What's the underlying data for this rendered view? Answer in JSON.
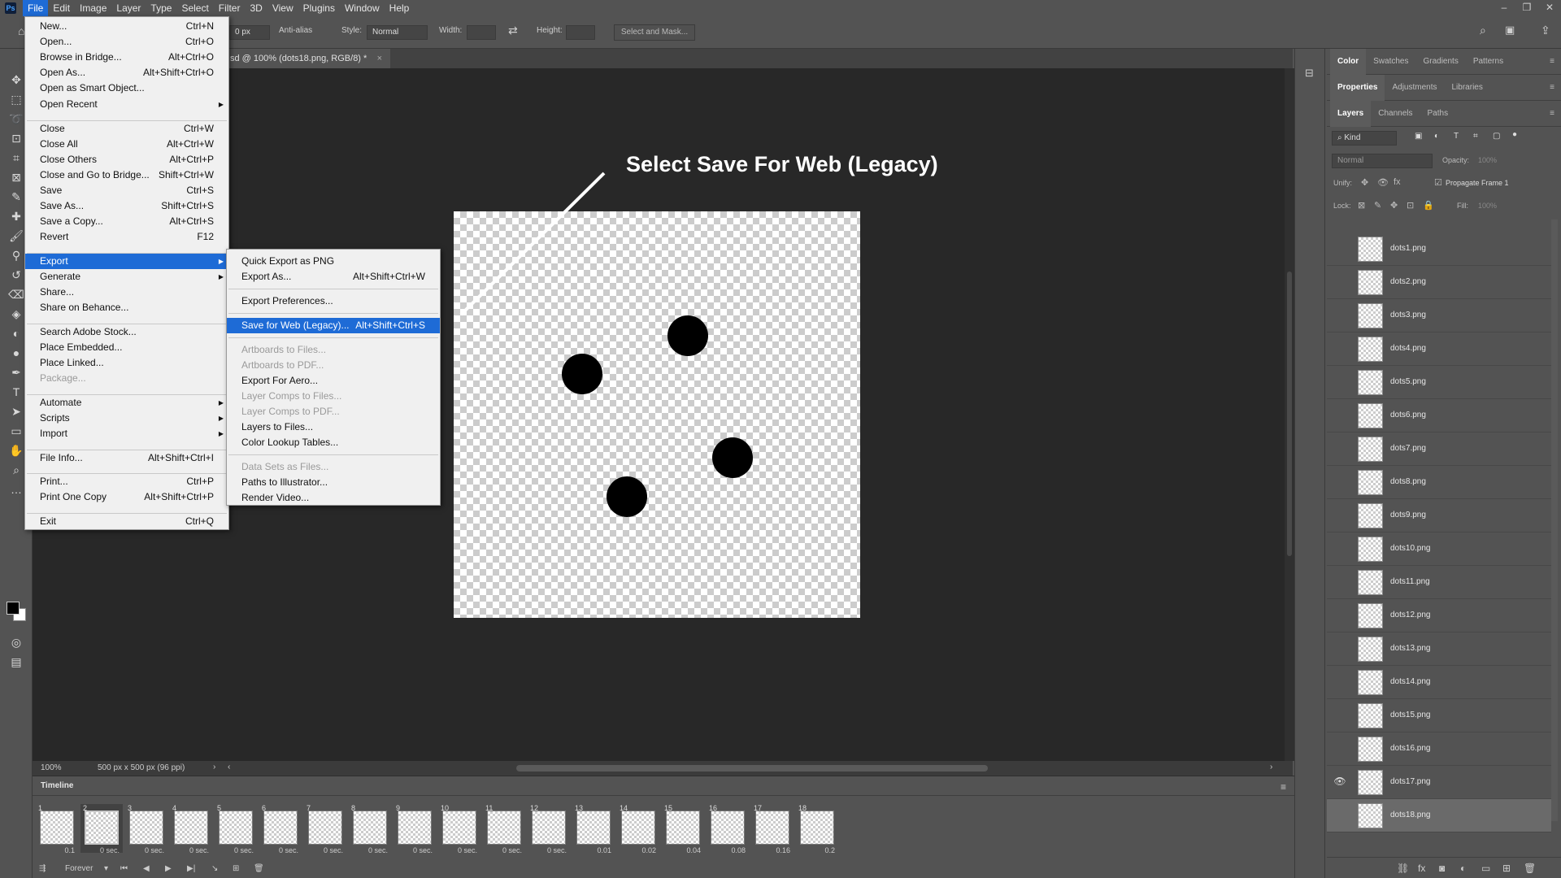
{
  "menubar": {
    "logo": "Ps",
    "items": [
      "File",
      "Edit",
      "Image",
      "Layer",
      "Type",
      "Select",
      "Filter",
      "3D",
      "View",
      "Plugins",
      "Window",
      "Help"
    ]
  },
  "options": {
    "feather_value": "0 px",
    "anti_alias": "Anti-alias",
    "style_label": "Style:",
    "style_value": "Normal",
    "width_label": "Width:",
    "height_label": "Height:",
    "select_mask": "Select and Mask..."
  },
  "document": {
    "tab_title": "sd @ 100% (dots18.png, RGB/8) *",
    "annotation": "Select Save For Web (Legacy)",
    "zoom": "100%",
    "doc_info": "500 px x 500 px (96 ppi)"
  },
  "file_menu": [
    {
      "label": "New...",
      "shortcut": "Ctrl+N"
    },
    {
      "label": "Open...",
      "shortcut": "Ctrl+O"
    },
    {
      "label": "Browse in Bridge...",
      "shortcut": "Alt+Ctrl+O"
    },
    {
      "label": "Open As...",
      "shortcut": "Alt+Shift+Ctrl+O"
    },
    {
      "label": "Open as Smart Object...",
      "shortcut": ""
    },
    {
      "label": "Open Recent",
      "shortcut": ""
    },
    {
      "label": "Close",
      "shortcut": "Ctrl+W"
    },
    {
      "label": "Close All",
      "shortcut": "Alt+Ctrl+W"
    },
    {
      "label": "Close Others",
      "shortcut": "Alt+Ctrl+P"
    },
    {
      "label": "Close and Go to Bridge...",
      "shortcut": "Shift+Ctrl+W"
    },
    {
      "label": "Save",
      "shortcut": "Ctrl+S"
    },
    {
      "label": "Save As...",
      "shortcut": "Shift+Ctrl+S"
    },
    {
      "label": "Save a Copy...",
      "shortcut": "Alt+Ctrl+S"
    },
    {
      "label": "Revert",
      "shortcut": "F12"
    },
    {
      "label": "Export",
      "shortcut": ""
    },
    {
      "label": "Generate",
      "shortcut": ""
    },
    {
      "label": "Share...",
      "shortcut": ""
    },
    {
      "label": "Share on Behance...",
      "shortcut": ""
    },
    {
      "label": "Search Adobe Stock...",
      "shortcut": ""
    },
    {
      "label": "Place Embedded...",
      "shortcut": ""
    },
    {
      "label": "Place Linked...",
      "shortcut": ""
    },
    {
      "label": "Package...",
      "shortcut": ""
    },
    {
      "label": "Automate",
      "shortcut": ""
    },
    {
      "label": "Scripts",
      "shortcut": ""
    },
    {
      "label": "Import",
      "shortcut": ""
    },
    {
      "label": "File Info...",
      "shortcut": "Alt+Shift+Ctrl+I"
    },
    {
      "label": "Print...",
      "shortcut": "Ctrl+P"
    },
    {
      "label": "Print One Copy",
      "shortcut": "Alt+Shift+Ctrl+P"
    },
    {
      "label": "Exit",
      "shortcut": "Ctrl+Q"
    }
  ],
  "export_menu": [
    {
      "label": "Quick Export as PNG",
      "shortcut": ""
    },
    {
      "label": "Export As...",
      "shortcut": "Alt+Shift+Ctrl+W"
    },
    {
      "label": "Export Preferences...",
      "shortcut": ""
    },
    {
      "label": "Save for Web (Legacy)...",
      "shortcut": "Alt+Shift+Ctrl+S"
    },
    {
      "label": "Artboards to Files...",
      "shortcut": ""
    },
    {
      "label": "Artboards to PDF...",
      "shortcut": ""
    },
    {
      "label": "Export For Aero...",
      "shortcut": ""
    },
    {
      "label": "Layer Comps to Files...",
      "shortcut": ""
    },
    {
      "label": "Layer Comps to PDF...",
      "shortcut": ""
    },
    {
      "label": "Layers to Files...",
      "shortcut": ""
    },
    {
      "label": "Color Lookup Tables...",
      "shortcut": ""
    },
    {
      "label": "Data Sets as Files...",
      "shortcut": ""
    },
    {
      "label": "Paths to Illustrator...",
      "shortcut": ""
    },
    {
      "label": "Render Video...",
      "shortcut": ""
    }
  ],
  "timeline": {
    "title": "Timeline",
    "frames": [
      {
        "num": "1",
        "delay": "0.1"
      },
      {
        "num": "2",
        "delay": "0 sec."
      },
      {
        "num": "3",
        "delay": "0 sec."
      },
      {
        "num": "4",
        "delay": "0 sec."
      },
      {
        "num": "5",
        "delay": "0 sec."
      },
      {
        "num": "6",
        "delay": "0 sec."
      },
      {
        "num": "7",
        "delay": "0 sec."
      },
      {
        "num": "8",
        "delay": "0 sec."
      },
      {
        "num": "9",
        "delay": "0 sec."
      },
      {
        "num": "10",
        "delay": "0 sec."
      },
      {
        "num": "11",
        "delay": "0 sec."
      },
      {
        "num": "12",
        "delay": "0 sec."
      },
      {
        "num": "13",
        "delay": "0.01"
      },
      {
        "num": "14",
        "delay": "0.02"
      },
      {
        "num": "15",
        "delay": "0.04"
      },
      {
        "num": "16",
        "delay": "0.08"
      },
      {
        "num": "17",
        "delay": "0.16"
      },
      {
        "num": "18",
        "delay": "0.2"
      }
    ],
    "loop": "Forever"
  },
  "panels": {
    "top_tabs": [
      "Color",
      "Swatches",
      "Gradients",
      "Patterns"
    ],
    "mid_tabs": [
      "Properties",
      "Adjustments",
      "Libraries"
    ],
    "layer_tabs": [
      "Layers",
      "Channels",
      "Paths"
    ],
    "kind": "Kind",
    "blend_mode": "Normal",
    "opacity_label": "Opacity:",
    "opacity_value": "100%",
    "unify_label": "Unify:",
    "propagate": "Propagate Frame 1",
    "lock_label": "Lock:",
    "fill_label": "Fill:",
    "fill_value": "100%"
  },
  "layers": [
    "dots1.png",
    "dots2.png",
    "dots3.png",
    "dots4.png",
    "dots5.png",
    "dots6.png",
    "dots7.png",
    "dots8.png",
    "dots9.png",
    "dots10.png",
    "dots11.png",
    "dots12.png",
    "dots13.png",
    "dots14.png",
    "dots15.png",
    "dots16.png",
    "dots17.png",
    "dots18.png"
  ],
  "colors": {
    "accent": "#1e6bd6",
    "ui_bg": "#535353",
    "canvas_bg": "#282828"
  }
}
